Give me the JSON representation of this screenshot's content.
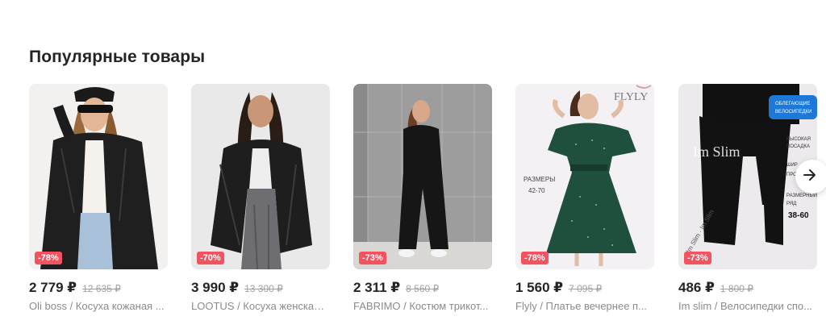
{
  "section": {
    "title": "Популярные товары"
  },
  "products": [
    {
      "price": "2 779 ₽",
      "old_price": "12 635 ₽",
      "discount": "-78%",
      "name": "Oli boss / Косуха кожаная ..."
    },
    {
      "price": "3 990 ₽",
      "old_price": "13 300 ₽",
      "discount": "-70%",
      "name": "LOOTUS / Косуха женская ..."
    },
    {
      "price": "2 311 ₽",
      "old_price": "8 560 ₽",
      "discount": "-73%",
      "name": "FABRIMO / Костюм трикот..."
    },
    {
      "price": "1 560 ₽",
      "old_price": "7 095 ₽",
      "discount": "-78%",
      "name": "Flyly / Платье вечернее п...",
      "image_texts": [
        "FLYLY",
        "РАЗМЕРЫ",
        "42-70"
      ]
    },
    {
      "price": "486 ₽",
      "old_price": "1 800 ₽",
      "discount": "-73%",
      "name": "Im slim / Велосипедки спо...",
      "image_texts": [
        "Im Slim",
        "ОБЛЕГАЮЩИЕ",
        "ВЕЛОСИПЕДКИ",
        "ВЫСОКАЯ",
        "ПОСАДКА",
        "ШИР",
        "ПРО",
        "РАЗМЕРНЫЙ",
        "РЯД",
        "38-60",
        "Im Slim · Im Slim"
      ]
    }
  ],
  "icons": {
    "next": "chevron-right-icon"
  },
  "colors": {
    "badge": "#f5515f",
    "text": "#242424",
    "muted": "#8b8b8b",
    "strike": "#a0a0a0"
  }
}
